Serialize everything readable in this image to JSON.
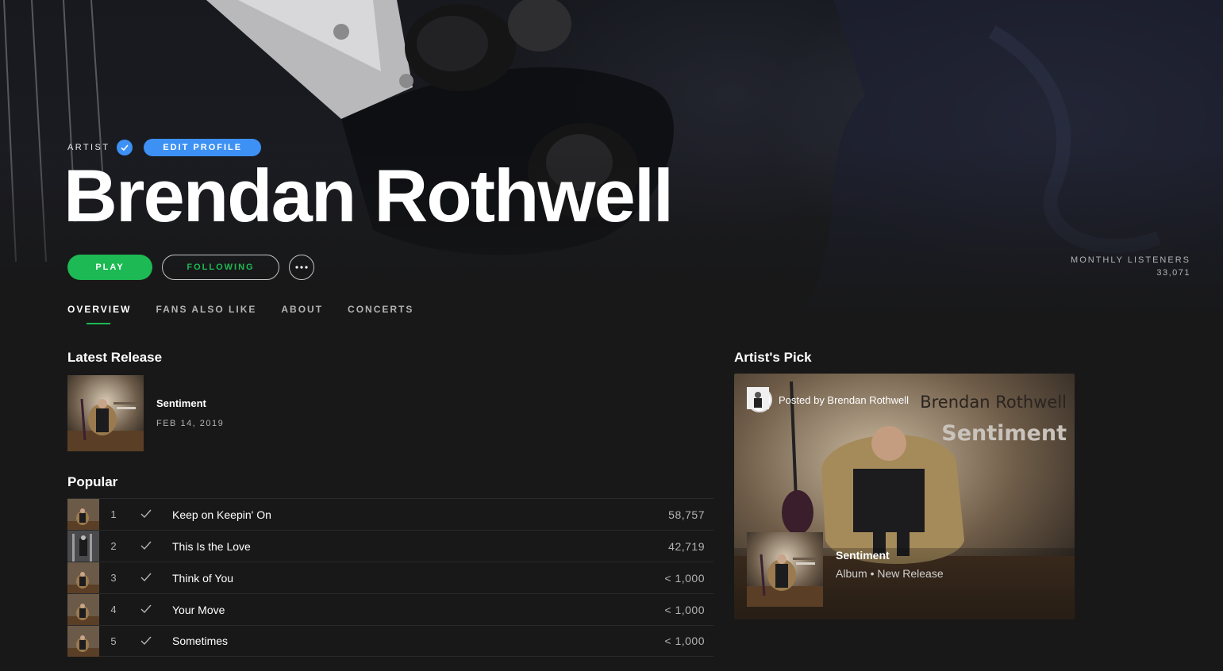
{
  "hero": {
    "artist_label": "ARTIST",
    "edit_profile_label": "EDIT PROFILE",
    "artist_name": "Brendan Rothwell",
    "play_label": "PLAY",
    "following_label": "FOLLOWING",
    "monthly_listeners_label": "MONTHLY LISTENERS",
    "monthly_listeners_value": "33,071"
  },
  "tabs": [
    {
      "label": "OVERVIEW",
      "active": true
    },
    {
      "label": "FANS ALSO LIKE",
      "active": false
    },
    {
      "label": "ABOUT",
      "active": false
    },
    {
      "label": "CONCERTS",
      "active": false
    }
  ],
  "latest_release": {
    "section_title": "Latest Release",
    "title": "Sentiment",
    "date": "FEB 14, 2019"
  },
  "popular": {
    "section_title": "Popular",
    "tracks": [
      {
        "num": "1",
        "name": "Keep on Keepin' On",
        "plays": "58,757"
      },
      {
        "num": "2",
        "name": "This Is the Love",
        "plays": "42,719"
      },
      {
        "num": "3",
        "name": "Think of You",
        "plays": "< 1,000"
      },
      {
        "num": "4",
        "name": "Your Move",
        "plays": "< 1,000"
      },
      {
        "num": "5",
        "name": "Sometimes",
        "plays": "< 1,000"
      }
    ]
  },
  "artists_pick": {
    "section_title": "Artist's Pick",
    "posted_by": "Posted by Brendan Rothwell",
    "cover_artist_text": "Brendan Rothwell",
    "cover_album_text": "Sentiment",
    "title": "Sentiment",
    "subtitle": "Album • New Release"
  },
  "colors": {
    "spotify_green": "#1db954",
    "verified_blue": "#3d91f4",
    "background": "#181818"
  },
  "icons": {
    "verified": "verified-check-icon",
    "more": "ellipsis-icon",
    "saved": "check-icon"
  }
}
